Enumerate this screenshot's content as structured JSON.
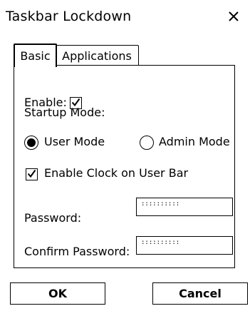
{
  "window": {
    "title": "Taskbar Lockdown",
    "close_glyph": "✕"
  },
  "tabs": [
    {
      "label": "Basic",
      "active": true
    },
    {
      "label": "Applications",
      "active": false
    }
  ],
  "basic": {
    "enable_label": "Enable:",
    "enable_checked": true,
    "startup_mode_label": "Startup Mode:",
    "modes": [
      {
        "label": "User Mode",
        "selected": true
      },
      {
        "label": "Admin Mode",
        "selected": false
      }
    ],
    "clock_label": "Enable Clock on User Bar",
    "clock_checked": true,
    "password_label": "Password:",
    "password_value": "::::::::::",
    "confirm_label": "Confirm Password:",
    "confirm_value": "::::::::::"
  },
  "buttons": {
    "ok": "OK",
    "cancel": "Cancel"
  },
  "icons": {
    "checkmark": "check-icon",
    "close": "close-icon",
    "radio_selected": "radio-selected-icon",
    "radio_empty": "radio-empty-icon"
  }
}
